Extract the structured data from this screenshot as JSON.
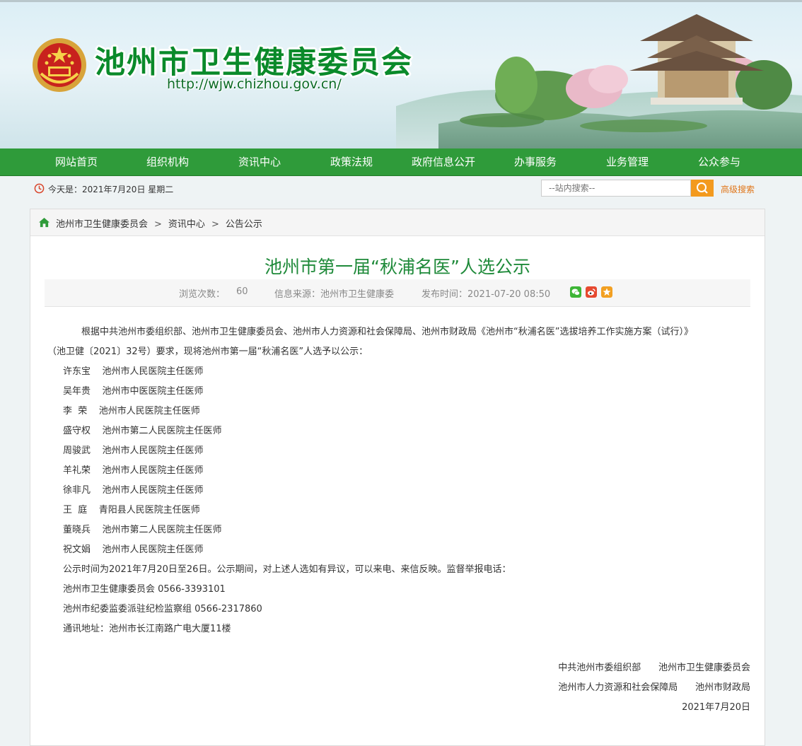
{
  "header": {
    "site_title": "池州市卫生健康委员会",
    "site_url": "http://wjw.chizhou.gov.cn/"
  },
  "nav": {
    "items": [
      {
        "label": "网站首页"
      },
      {
        "label": "组织机构"
      },
      {
        "label": "资讯中心"
      },
      {
        "label": "政策法规"
      },
      {
        "label": "政府信息公开"
      },
      {
        "label": "办事服务"
      },
      {
        "label": "业务管理"
      },
      {
        "label": "公众参与"
      }
    ]
  },
  "infobar": {
    "today": "今天是：2021年7月20日 星期二",
    "search_placeholder": "--站内搜索--",
    "advanced_search": "高级搜索"
  },
  "breadcrumb": {
    "items": [
      "池州市卫生健康委员会",
      "资讯中心",
      "公告公示"
    ],
    "separator": ">"
  },
  "article": {
    "title": "池州市第一届“秋浦名医”人选公示",
    "views_label": "浏览次数：",
    "views": "60",
    "source": "信息来源：池州市卫生健康委",
    "published": "发布时间：2021-07-20 08:50",
    "intro_line1": "根据中共池州市委组织部、池州市卫生健康委员会、池州市人力资源和社会保障局、池州市财政局《池州市“秋浦名医”选拔培养工作实施方案（试行）》",
    "intro_line2": "（池卫健〔2021〕32号）要求，现将池州市第一届“秋浦名医”人选予以公示：",
    "people": [
      {
        "name": "许东宝",
        "unit": "池州市人民医院主任医师"
      },
      {
        "name": "吴年贵",
        "unit": "池州市中医医院主任医师"
      },
      {
        "name": "李  荣",
        "unit": "池州市人民医院主任医师"
      },
      {
        "name": "盛守权",
        "unit": "池州市第二人民医院主任医师"
      },
      {
        "name": "周骏武",
        "unit": "池州市人民医院主任医师"
      },
      {
        "name": "羊礼荣",
        "unit": "池州市人民医院主任医师"
      },
      {
        "name": "徐非凡",
        "unit": "池州市人民医院主任医师"
      },
      {
        "name": "王  庭",
        "unit": "青阳县人民医院主任医师"
      },
      {
        "name": "董晓兵",
        "unit": "池州市第二人民医院主任医师"
      },
      {
        "name": "祝文娟",
        "unit": "池州市人民医院主任医师"
      }
    ],
    "notice": "公示时间为2021年7月20日至26日。公示期间，对上述人选如有异议，可以来电、来信反映。监督举报电话：",
    "phone1": "池州市卫生健康委员会 0566-3393101",
    "phone2": "池州市纪委监委派驻纪检监察组 0566-2317860",
    "address": "通讯地址：池州市长江南路广电大厦11楼",
    "signers_line1": "中共池州市委组织部      池州市卫生健康委员会",
    "signers_line2": "池州市人力资源和社会保障局      池州市财政局",
    "sign_date": "2021年7月20日"
  },
  "colors": {
    "nav_green": "#2f9b3a",
    "title_green": "#1f8a3a",
    "search_orange": "#f39a1e"
  }
}
